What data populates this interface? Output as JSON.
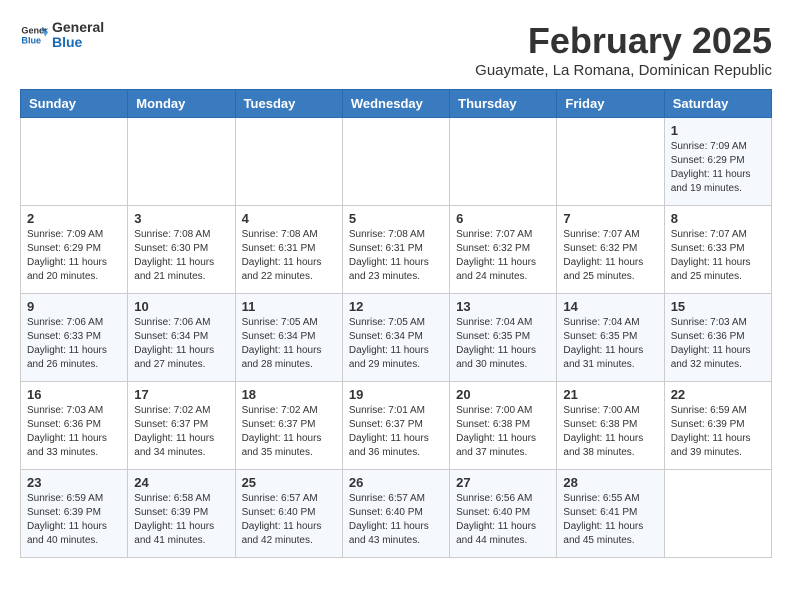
{
  "logo": {
    "line1": "General",
    "line2": "Blue"
  },
  "title": "February 2025",
  "subtitle": "Guaymate, La Romana, Dominican Republic",
  "days_of_week": [
    "Sunday",
    "Monday",
    "Tuesday",
    "Wednesday",
    "Thursday",
    "Friday",
    "Saturday"
  ],
  "weeks": [
    [
      {
        "day": "",
        "info": ""
      },
      {
        "day": "",
        "info": ""
      },
      {
        "day": "",
        "info": ""
      },
      {
        "day": "",
        "info": ""
      },
      {
        "day": "",
        "info": ""
      },
      {
        "day": "",
        "info": ""
      },
      {
        "day": "1",
        "info": "Sunrise: 7:09 AM\nSunset: 6:29 PM\nDaylight: 11 hours\nand 19 minutes."
      }
    ],
    [
      {
        "day": "2",
        "info": "Sunrise: 7:09 AM\nSunset: 6:29 PM\nDaylight: 11 hours\nand 20 minutes."
      },
      {
        "day": "3",
        "info": "Sunrise: 7:08 AM\nSunset: 6:30 PM\nDaylight: 11 hours\nand 21 minutes."
      },
      {
        "day": "4",
        "info": "Sunrise: 7:08 AM\nSunset: 6:31 PM\nDaylight: 11 hours\nand 22 minutes."
      },
      {
        "day": "5",
        "info": "Sunrise: 7:08 AM\nSunset: 6:31 PM\nDaylight: 11 hours\nand 23 minutes."
      },
      {
        "day": "6",
        "info": "Sunrise: 7:07 AM\nSunset: 6:32 PM\nDaylight: 11 hours\nand 24 minutes."
      },
      {
        "day": "7",
        "info": "Sunrise: 7:07 AM\nSunset: 6:32 PM\nDaylight: 11 hours\nand 25 minutes."
      },
      {
        "day": "8",
        "info": "Sunrise: 7:07 AM\nSunset: 6:33 PM\nDaylight: 11 hours\nand 25 minutes."
      }
    ],
    [
      {
        "day": "9",
        "info": "Sunrise: 7:06 AM\nSunset: 6:33 PM\nDaylight: 11 hours\nand 26 minutes."
      },
      {
        "day": "10",
        "info": "Sunrise: 7:06 AM\nSunset: 6:34 PM\nDaylight: 11 hours\nand 27 minutes."
      },
      {
        "day": "11",
        "info": "Sunrise: 7:05 AM\nSunset: 6:34 PM\nDaylight: 11 hours\nand 28 minutes."
      },
      {
        "day": "12",
        "info": "Sunrise: 7:05 AM\nSunset: 6:34 PM\nDaylight: 11 hours\nand 29 minutes."
      },
      {
        "day": "13",
        "info": "Sunrise: 7:04 AM\nSunset: 6:35 PM\nDaylight: 11 hours\nand 30 minutes."
      },
      {
        "day": "14",
        "info": "Sunrise: 7:04 AM\nSunset: 6:35 PM\nDaylight: 11 hours\nand 31 minutes."
      },
      {
        "day": "15",
        "info": "Sunrise: 7:03 AM\nSunset: 6:36 PM\nDaylight: 11 hours\nand 32 minutes."
      }
    ],
    [
      {
        "day": "16",
        "info": "Sunrise: 7:03 AM\nSunset: 6:36 PM\nDaylight: 11 hours\nand 33 minutes."
      },
      {
        "day": "17",
        "info": "Sunrise: 7:02 AM\nSunset: 6:37 PM\nDaylight: 11 hours\nand 34 minutes."
      },
      {
        "day": "18",
        "info": "Sunrise: 7:02 AM\nSunset: 6:37 PM\nDaylight: 11 hours\nand 35 minutes."
      },
      {
        "day": "19",
        "info": "Sunrise: 7:01 AM\nSunset: 6:37 PM\nDaylight: 11 hours\nand 36 minutes."
      },
      {
        "day": "20",
        "info": "Sunrise: 7:00 AM\nSunset: 6:38 PM\nDaylight: 11 hours\nand 37 minutes."
      },
      {
        "day": "21",
        "info": "Sunrise: 7:00 AM\nSunset: 6:38 PM\nDaylight: 11 hours\nand 38 minutes."
      },
      {
        "day": "22",
        "info": "Sunrise: 6:59 AM\nSunset: 6:39 PM\nDaylight: 11 hours\nand 39 minutes."
      }
    ],
    [
      {
        "day": "23",
        "info": "Sunrise: 6:59 AM\nSunset: 6:39 PM\nDaylight: 11 hours\nand 40 minutes."
      },
      {
        "day": "24",
        "info": "Sunrise: 6:58 AM\nSunset: 6:39 PM\nDaylight: 11 hours\nand 41 minutes."
      },
      {
        "day": "25",
        "info": "Sunrise: 6:57 AM\nSunset: 6:40 PM\nDaylight: 11 hours\nand 42 minutes."
      },
      {
        "day": "26",
        "info": "Sunrise: 6:57 AM\nSunset: 6:40 PM\nDaylight: 11 hours\nand 43 minutes."
      },
      {
        "day": "27",
        "info": "Sunrise: 6:56 AM\nSunset: 6:40 PM\nDaylight: 11 hours\nand 44 minutes."
      },
      {
        "day": "28",
        "info": "Sunrise: 6:55 AM\nSunset: 6:41 PM\nDaylight: 11 hours\nand 45 minutes."
      },
      {
        "day": "",
        "info": ""
      }
    ]
  ]
}
